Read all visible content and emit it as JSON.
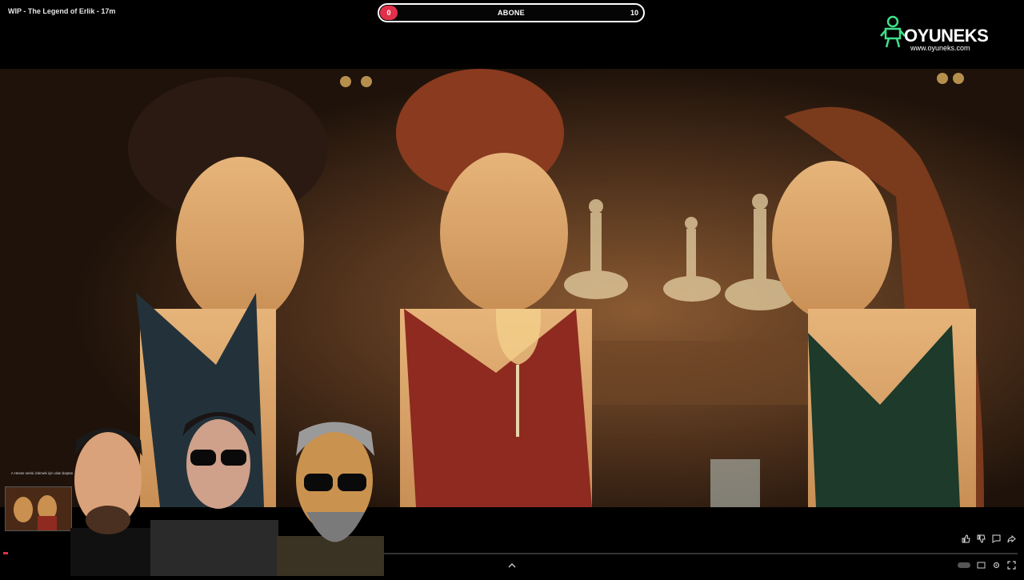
{
  "stream": {
    "title": "WIP - The Legend of Erlik - 17m"
  },
  "subscriber_goal": {
    "current": "0",
    "label": "ABONE",
    "target": "10",
    "accent_color": "#e0304a"
  },
  "brand": {
    "name": "OYUNEKS",
    "url": "www.oyuneks.com",
    "icon": "mascot-logo",
    "color": "#3ee08a"
  },
  "thumbnail": {
    "caption": "A Hesse serisi izlemek için olan baştan"
  },
  "icons": {
    "like": "thumbs-up-icon",
    "dislike": "thumbs-down-icon",
    "chat": "chat-icon",
    "share": "share-icon",
    "settings": "gear-icon",
    "fullscreen": "fullscreen-icon",
    "expand": "chevron-up-icon"
  }
}
